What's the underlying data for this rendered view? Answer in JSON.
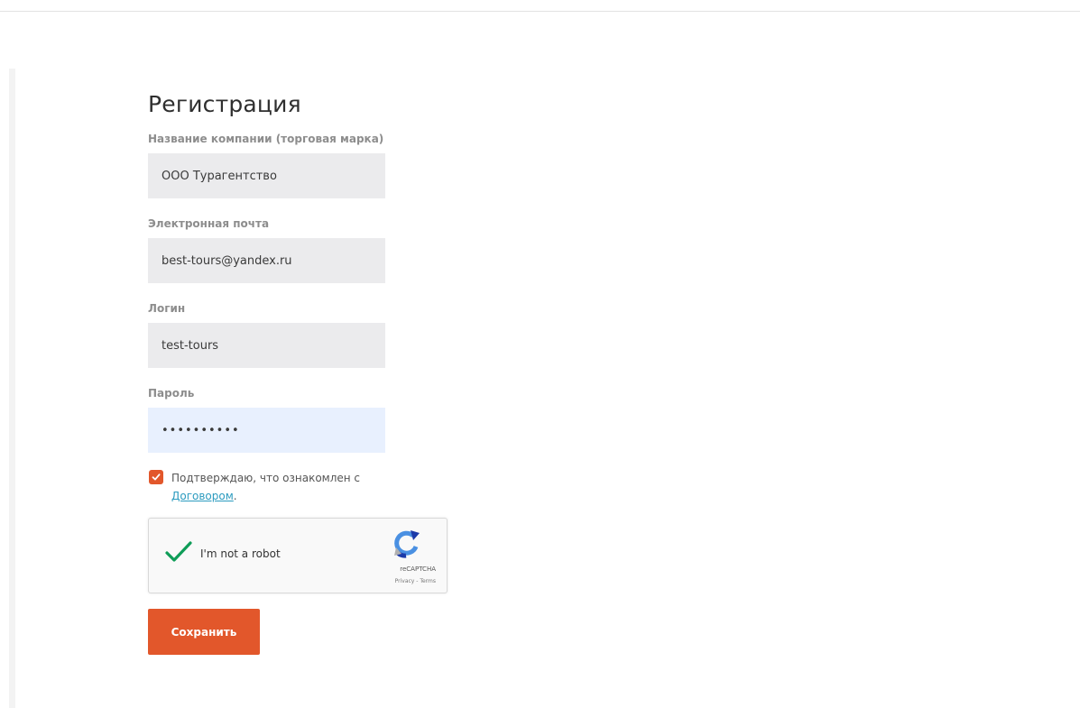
{
  "form": {
    "title": "Регистрация",
    "company": {
      "label": "Название компании (торговая марка)",
      "value": "ООО Турагентство"
    },
    "email": {
      "label": "Электронная почта",
      "value": "best-tours@yandex.ru"
    },
    "login": {
      "label": "Логин",
      "value": "test-tours"
    },
    "password": {
      "label": "Пароль",
      "value": "••••••••••"
    },
    "agree": {
      "checked": true,
      "text": "Подтверждаю, что ознакомлен с ",
      "link": "Договором",
      "suffix": "."
    },
    "captcha": {
      "checked": true,
      "label": "I'm not a robot",
      "brand": "reCAPTCHA",
      "terms": "Privacy - Terms"
    },
    "save_label": "Сохранить"
  },
  "colors": {
    "accent": "#e2572b",
    "link": "#2b9bbf",
    "input_bg": "#ebebed",
    "autofill_bg": "#e8f0fe",
    "captcha_check": "#0f9d58"
  }
}
